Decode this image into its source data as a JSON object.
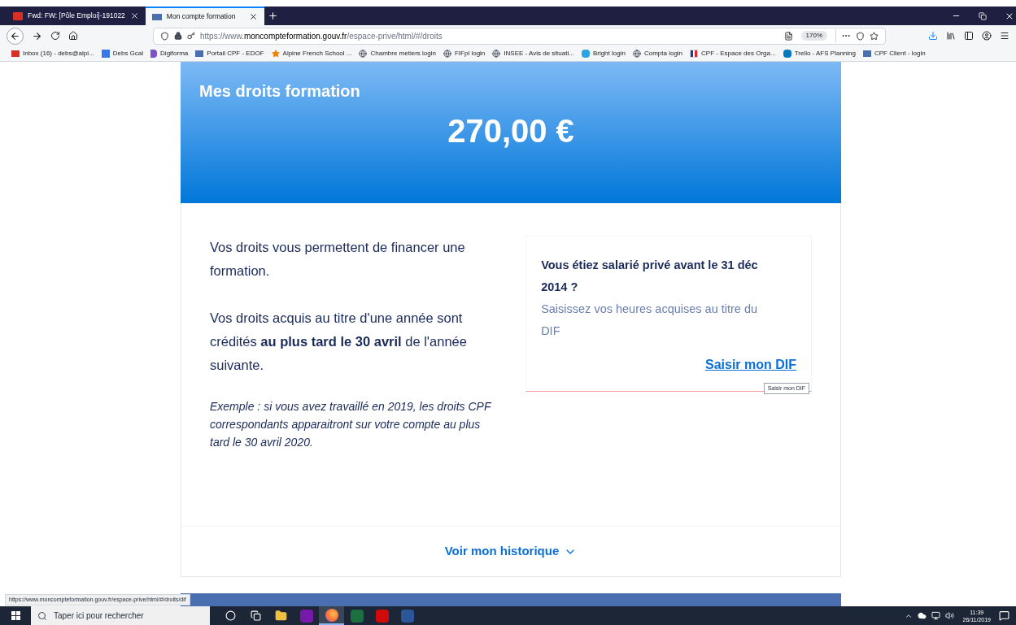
{
  "tabs": [
    {
      "label": "Fwd: FW: [Pôle Emploi]-191022",
      "kind": "mail",
      "selected": false
    },
    {
      "label": "Mon compte formation",
      "kind": "site",
      "selected": true
    }
  ],
  "address": {
    "prefix": "https://www.",
    "domain": "moncompteformation.gouv.fr",
    "path": "/espace-prive/html/#/droits",
    "zoom": "170%"
  },
  "bookmarks": [
    {
      "label": "Inbox (16) - debs@alpi...",
      "kind": "mail"
    },
    {
      "label": "Debs Gcal",
      "kind": "calendar"
    },
    {
      "label": "Digiforma",
      "kind": "letter"
    },
    {
      "label": "Portail CPF - EDOF",
      "kind": "site"
    },
    {
      "label": "Alpine French School ...",
      "kind": "star"
    },
    {
      "label": "Chambre metiers login",
      "kind": "globe"
    },
    {
      "label": "FIFpl login",
      "kind": "globe"
    },
    {
      "label": "INSEE - Avis de situati...",
      "kind": "globe"
    },
    {
      "label": "Bright login",
      "kind": "bright"
    },
    {
      "label": "Compta login",
      "kind": "globe"
    },
    {
      "label": "CPF - Espace des Orga...",
      "kind": "flag"
    },
    {
      "label": "Trello - AFS Planning",
      "kind": "trello"
    },
    {
      "label": "CPF Client - login",
      "kind": "site"
    }
  ],
  "header": {
    "title": "Mes droits formation",
    "amount": "270,00 €"
  },
  "info": {
    "paragraphs": [
      "Vos droits vous permettent de financer une formation.",
      "Vos droits acquis au titre d'une année sont crédités **au plus tard le 30 avril** de l'année suivante."
    ],
    "example": "Exemple : si vous avez travaillé en 2019, les droits CPF correspondants apparaitront sur votre compte au plus tard le 30 avril 2020."
  },
  "dif_card": {
    "question": "Vous étiez salarié privé avant le 31 déc 2014 ?",
    "text": "Saisissez vos heures acquises au titre du DIF",
    "link": "Saisir mon DIF",
    "tooltip": "Saisir mon DIF"
  },
  "history": {
    "label": "Voir mon historique",
    "expanded": false
  },
  "status_url": "https://www.moncompteformation.gouv.fr/espace-prive/html/#/droits/dif",
  "taskbar": {
    "search_placeholder": "Taper ici pour rechercher",
    "apps": [
      {
        "kind": "cortana",
        "selected": false
      },
      {
        "kind": "taskview",
        "selected": false
      },
      {
        "kind": "explorer",
        "selected": false
      },
      {
        "kind": "onenote",
        "selected": false
      },
      {
        "kind": "firefox",
        "selected": true
      },
      {
        "kind": "excel",
        "selected": false
      },
      {
        "kind": "acrobat",
        "selected": false
      },
      {
        "kind": "word",
        "selected": false
      }
    ],
    "time": "11:39",
    "date": "26/11/2019"
  }
}
